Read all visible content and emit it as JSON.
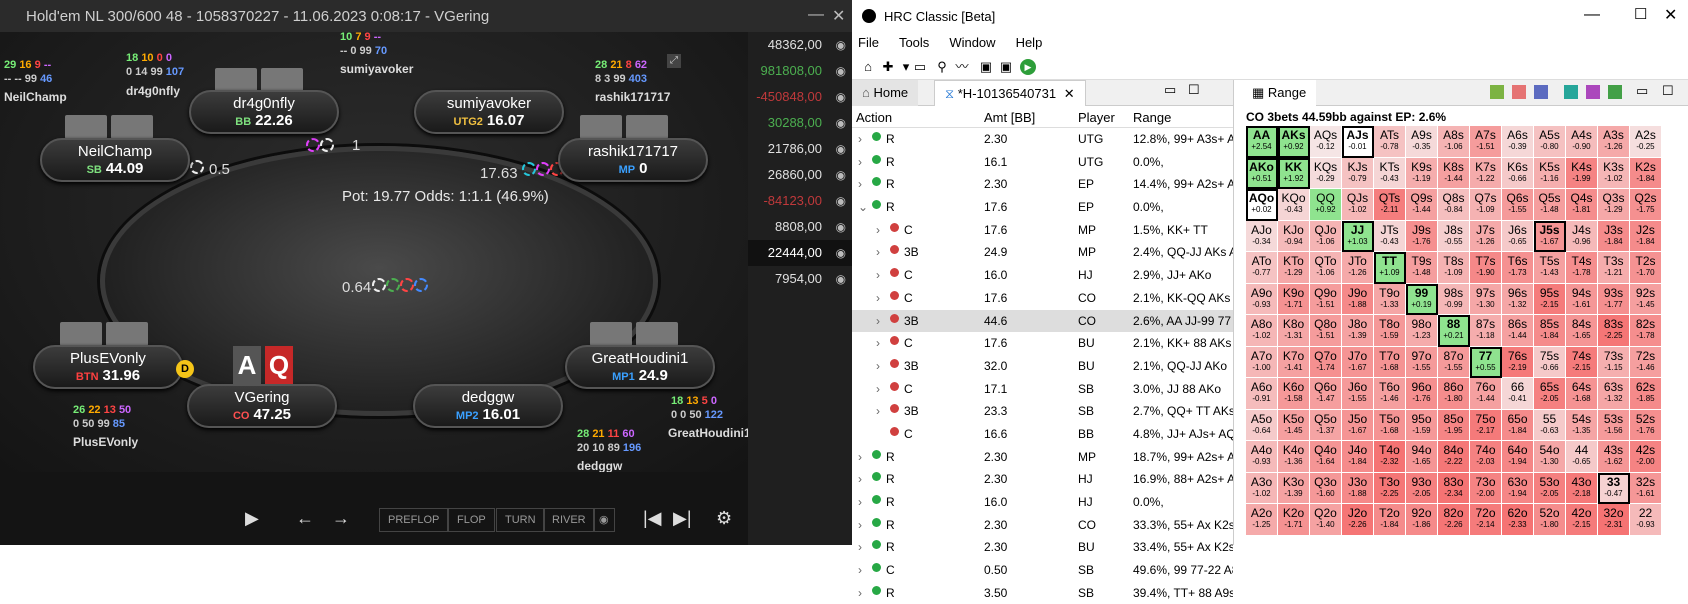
{
  "poker": {
    "title": "Hold'em NL 300/600 48 - 1058370227 - 11.06.2023 0:08:17 - VGering",
    "pot": "Pot:  19.77    Odds:  1:1.1 (46.9%)",
    "bet_center": "0.64",
    "bet_rashik": "17.63",
    "bet_dr4g": "1",
    "bet_neil": "0.5",
    "hole_cards": [
      "A",
      "Q"
    ],
    "seats": [
      {
        "name": "dr4g0nfly",
        "pos": "BB",
        "stack": "22.26",
        "poscolor": "#7ee07e"
      },
      {
        "name": "sumiyavoker",
        "pos": "UTG2",
        "stack": "16.07",
        "poscolor": "#f0c040"
      },
      {
        "name": "NeilChamp",
        "pos": "SB",
        "stack": "44.09",
        "poscolor": "#7ee07e"
      },
      {
        "name": "rashik171717",
        "pos": "MP",
        "stack": "0",
        "poscolor": "#3aa0ff"
      },
      {
        "name": "PlusEVonly",
        "pos": "BTN",
        "stack": "31.96",
        "poscolor": "#ff4040"
      },
      {
        "name": "GreatHoudini1",
        "pos": "MP1",
        "stack": "24.9",
        "poscolor": "#3aa0ff"
      },
      {
        "name": "VGering",
        "pos": "CO",
        "stack": "47.25",
        "poscolor": "#ff5050"
      },
      {
        "name": "dedggw",
        "pos": "MP2",
        "stack": "16.01",
        "poscolor": "#3aa0ff"
      }
    ],
    "stat_labels": {
      "neil": "NeilChamp",
      "dr4g": "dr4g0nfly",
      "sumi": "sumiyavoker",
      "rashik": "rashik171717",
      "plus": "PlusEVonly",
      "great": "GreatHoudini1",
      "dedg": "dedggw"
    },
    "stats": {
      "neil": [
        "29",
        "16",
        "9",
        "--",
        "-- -- 99",
        "46"
      ],
      "dr4g": [
        "18",
        "10",
        "0",
        "0",
        "0 14 99",
        "107"
      ],
      "sumi": [
        "10",
        "7",
        "9",
        "--",
        "-- 0 99",
        "70"
      ],
      "rashik": [
        "28",
        "21",
        "8",
        "62",
        "8 3 99",
        "403"
      ],
      "plus": [
        "26",
        "22",
        "13",
        "50",
        "0 50 99",
        "85"
      ],
      "great": [
        "18",
        "13",
        "5",
        "0",
        "0 0 50",
        "122"
      ],
      "dedg": [
        "28",
        "21",
        "11",
        "60",
        "20 10 89",
        "196"
      ]
    },
    "streets": [
      "PREFLOP",
      "FLOP",
      "TURN",
      "RIVER"
    ],
    "sidebar": [
      {
        "v": "48362,00",
        "c": "#e0e0e0"
      },
      {
        "v": "981808,00",
        "c": "#4caf50"
      },
      {
        "v": "-450848,00",
        "c": "#c0393b"
      },
      {
        "v": "30288,00",
        "c": "#4caf50"
      },
      {
        "v": "21786,00",
        "c": "#e0e0e0"
      },
      {
        "v": "26860,00",
        "c": "#e0e0e0"
      },
      {
        "v": "-84123,00",
        "c": "#c0393b"
      },
      {
        "v": "8808,00",
        "c": "#e0e0e0"
      },
      {
        "v": "22444,00",
        "c": "#ffffff"
      },
      {
        "v": "7954,00",
        "c": "#e0e0e0"
      }
    ]
  },
  "hrc": {
    "title": "HRC Classic [Beta]",
    "menu": [
      "File",
      "Tools",
      "Window",
      "Help"
    ],
    "tab_home": "Home",
    "tab_hand": "*H-10136540731",
    "headers": {
      "action": "Action",
      "amt": "Amt [BB]",
      "player": "Player",
      "range": "Range"
    },
    "rows": [
      {
        "a": "R",
        "amt": "2.30",
        "p": "UTG",
        "r": "12.8%, 99+ A3s+ ATo+ K9s",
        "d": "#27a845",
        "lvl": 0,
        "exp": ">"
      },
      {
        "a": "R",
        "amt": "16.1",
        "p": "UTG",
        "r": "0.0%,",
        "d": "#27a845",
        "lvl": 0,
        "exp": ">"
      },
      {
        "a": "R",
        "amt": "2.30",
        "p": "EP",
        "r": "14.4%, 99+ A2s+ ATo+ K9s",
        "d": "#27a845",
        "lvl": 0,
        "exp": ">"
      },
      {
        "a": "R",
        "amt": "17.6",
        "p": "EP",
        "r": "0.0%,",
        "d": "#27a845",
        "lvl": 0,
        "exp": "v"
      },
      {
        "a": "C",
        "amt": "17.6",
        "p": "MP",
        "r": "1.5%, KK+ TT",
        "d": "#d0403f",
        "lvl": 1,
        "exp": ">"
      },
      {
        "a": "3B",
        "amt": "24.9",
        "p": "MP",
        "r": "2.4%, QQ-JJ AKs AKo",
        "d": "#d0403f",
        "lvl": 1,
        "exp": ">"
      },
      {
        "a": "C",
        "amt": "16.0",
        "p": "HJ",
        "r": "2.9%, JJ+ AKo",
        "d": "#d0403f",
        "lvl": 1,
        "exp": ">"
      },
      {
        "a": "C",
        "amt": "17.6",
        "p": "CO",
        "r": "2.1%, KK-QQ AKs",
        "d": "#d0403f",
        "lvl": 1,
        "exp": ">"
      },
      {
        "a": "3B",
        "amt": "44.6",
        "p": "CO",
        "r": "2.6%, AA JJ-99 77",
        "d": "#d0403f",
        "lvl": 1,
        "exp": ">",
        "sel": true
      },
      {
        "a": "C",
        "amt": "17.6",
        "p": "BU",
        "r": "2.1%, KK+ 88 AKs",
        "d": "#d0403f",
        "lvl": 1,
        "exp": ">"
      },
      {
        "a": "3B",
        "amt": "32.0",
        "p": "BU",
        "r": "2.1%, QQ-JJ AKo",
        "d": "#d0403f",
        "lvl": 1,
        "exp": ">"
      },
      {
        "a": "C",
        "amt": "17.1",
        "p": "SB",
        "r": "3.0%, JJ 88 AKo",
        "d": "#d0403f",
        "lvl": 1,
        "exp": ">"
      },
      {
        "a": "3B",
        "amt": "23.3",
        "p": "SB",
        "r": "2.7%, QQ+ TT AKs",
        "d": "#d0403f",
        "lvl": 1,
        "exp": ">"
      },
      {
        "a": "C",
        "amt": "16.6",
        "p": "BB",
        "r": "4.8%, JJ+ AJs+ AQo+",
        "d": "#d0403f",
        "lvl": 1,
        "exp": ""
      },
      {
        "a": "R",
        "amt": "2.30",
        "p": "MP",
        "r": "18.7%, 99+ A2s+ A8o+ A5o",
        "d": "#27a845",
        "lvl": 0,
        "exp": ">"
      },
      {
        "a": "R",
        "amt": "2.30",
        "p": "HJ",
        "r": "16.9%, 88+ A2s+ A9o+ K9s",
        "d": "#27a845",
        "lvl": 0,
        "exp": ">"
      },
      {
        "a": "R",
        "amt": "16.0",
        "p": "HJ",
        "r": "0.0%,",
        "d": "#27a845",
        "lvl": 0,
        "exp": ">"
      },
      {
        "a": "R",
        "amt": "2.30",
        "p": "CO",
        "r": "33.3%, 55+ Ax K2s+ K9o+",
        "d": "#27a845",
        "lvl": 0,
        "exp": ">"
      },
      {
        "a": "R",
        "amt": "2.30",
        "p": "BU",
        "r": "33.4%, 55+ Ax K2s+ K9o+",
        "d": "#27a845",
        "lvl": 0,
        "exp": ">"
      },
      {
        "a": "C",
        "amt": "0.50",
        "p": "SB",
        "r": "49.6%, 99 77-22 A8s-A2s A",
        "d": "#27a845",
        "lvl": 0,
        "exp": ">"
      },
      {
        "a": "R",
        "amt": "3.50",
        "p": "SB",
        "r": "39.4%, TT+ 88 A9s+ A9o+",
        "d": "#27a845",
        "lvl": 0,
        "exp": ">"
      }
    ],
    "range_tab": "Range",
    "range_title": "CO 3bets 44.59bb against EP: 2.6%",
    "grid": [
      [
        "AA|+2.54",
        "AKs|+0.92",
        "AQs|-0.12",
        "AJs|-0.01",
        "ATs|-0.78",
        "A9s|-0.35",
        "A8s|-1.06",
        "A7s|-1.51",
        "A6s|-0.39",
        "A5s|-0.80",
        "A4s|-0.90",
        "A3s|-1.26",
        "A2s|-0.25"
      ],
      [
        "AKo|+0.51",
        "KK|+1.92",
        "KQs|-0.29",
        "KJs|-0.79",
        "KTs|-0.43",
        "K9s|-1.19",
        "K8s|-1.44",
        "K7s|-1.22",
        "K6s|-0.66",
        "K5s|-1.16",
        "K4s|-1.99",
        "K3s|-1.02",
        "K2s|-1.84"
      ],
      [
        "AQo|+0.02",
        "KQo|-0.43",
        "QQ|+0.92",
        "QJs|-1.02",
        "QTs|-2.11",
        "Q9s|-1.44",
        "Q8s|-0.84",
        "Q7s|-1.09",
        "Q6s|-1.55",
        "Q5s|-1.48",
        "Q4s|-1.81",
        "Q3s|-1.29",
        "Q2s|-1.75"
      ],
      [
        "AJo|-0.34",
        "KJo|-0.94",
        "QJo|-1.06",
        "JJ|+1.03",
        "JTs|-0.43",
        "J9s|-1.76",
        "J8s|-0.55",
        "J7s|-1.26",
        "J6s|-0.65",
        "J5s|-1.67",
        "J4s|-0.96",
        "J3s|-1.84",
        "J2s|-1.84"
      ],
      [
        "ATo|-0.77",
        "KTo|-1.29",
        "QTo|-1.06",
        "JTo|-1.26",
        "TT|+1.09",
        "T9s|-1.48",
        "T8s|-1.09",
        "T7s|-1.90",
        "T6s|-1.73",
        "T5s|-1.43",
        "T4s|-1.78",
        "T3s|-1.21",
        "T2s|-1.70"
      ],
      [
        "A9o|-0.93",
        "K9o|-1.71",
        "Q9o|-1.51",
        "J9o|-1.88",
        "T9o|-1.33",
        "99|+0.19",
        "98s|-0.99",
        "97s|-1.30",
        "96s|-1.32",
        "95s|-2.15",
        "94s|-1.61",
        "93s|-1.77",
        "92s|-1.45"
      ],
      [
        "A8o|-1.02",
        "K8o|-1.31",
        "Q8o|-1.51",
        "J8o|-1.39",
        "T8o|-1.59",
        "98o|-1.23",
        "88|+0.21",
        "87s|-1.18",
        "86s|-1.44",
        "85s|-1.84",
        "84s|-1.65",
        "83s|-2.25",
        "82s|-1.78"
      ],
      [
        "A7o|-1.00",
        "K7o|-1.41",
        "Q7o|-1.74",
        "J7o|-1.67",
        "T7o|-1.68",
        "97o|-1.55",
        "87o|-1.55",
        "77|+0.55",
        "76s|-2.19",
        "75s|-0.66",
        "74s|-2.15",
        "73s|-1.15",
        "72s|-1.46"
      ],
      [
        "A6o|-0.91",
        "K6o|-1.58",
        "Q6o|-1.47",
        "J6o|-1.55",
        "T6o|-1.46",
        "96o|-1.76",
        "86o|-1.80",
        "76o|-1.44",
        "66|-0.41",
        "65s|-2.05",
        "64s|-1.68",
        "63s|-1.32",
        "62s|-1.85"
      ],
      [
        "A5o|-0.64",
        "K5o|-1.45",
        "Q5o|-1.37",
        "J5o|-1.67",
        "T5o|-1.68",
        "95o|-1.59",
        "85o|-1.95",
        "75o|-2.17",
        "65o|-1.84",
        "55|-0.63",
        "54s|-1.35",
        "53s|-1.56",
        "52s|-1.76"
      ],
      [
        "A4o|-0.93",
        "K4o|-1.36",
        "Q4o|-1.64",
        "J4o|-1.84",
        "T4o|-2.32",
        "94o|-1.65",
        "84o|-2.22",
        "74o|-2.03",
        "64o|-1.94",
        "54o|-1.30",
        "44|-0.65",
        "43s|-1.62",
        "42s|-2.00"
      ],
      [
        "A3o|-1.02",
        "K3o|-1.39",
        "Q3o|-1.60",
        "J3o|-1.88",
        "T3o|-2.25",
        "93o|-2.05",
        "83o|-2.34",
        "73o|-2.00",
        "63o|-1.94",
        "53o|-2.05",
        "43o|-2.18",
        "33|-0.47",
        "32s|-1.61"
      ],
      [
        "A2o|-1.25",
        "K2o|-1.71",
        "Q2o|-1.40",
        "J2o|-2.26",
        "T2o|-1.84",
        "92o|-1.86",
        "82o|-2.26",
        "72o|-2.14",
        "62o|-2.33",
        "52o|-1.80",
        "42o|-2.15",
        "32o|-2.31",
        "22|-0.93"
      ]
    ],
    "boxed": [
      "AA",
      "AKs",
      "AJs",
      "AKo",
      "KK",
      "AQo",
      "JJ",
      "TT",
      "99",
      "88",
      "77",
      "J5s",
      "33"
    ],
    "green": [
      "AA",
      "AKs",
      "AKo",
      "KK",
      "QQ",
      "JJ",
      "TT",
      "99",
      "88",
      "77"
    ]
  }
}
